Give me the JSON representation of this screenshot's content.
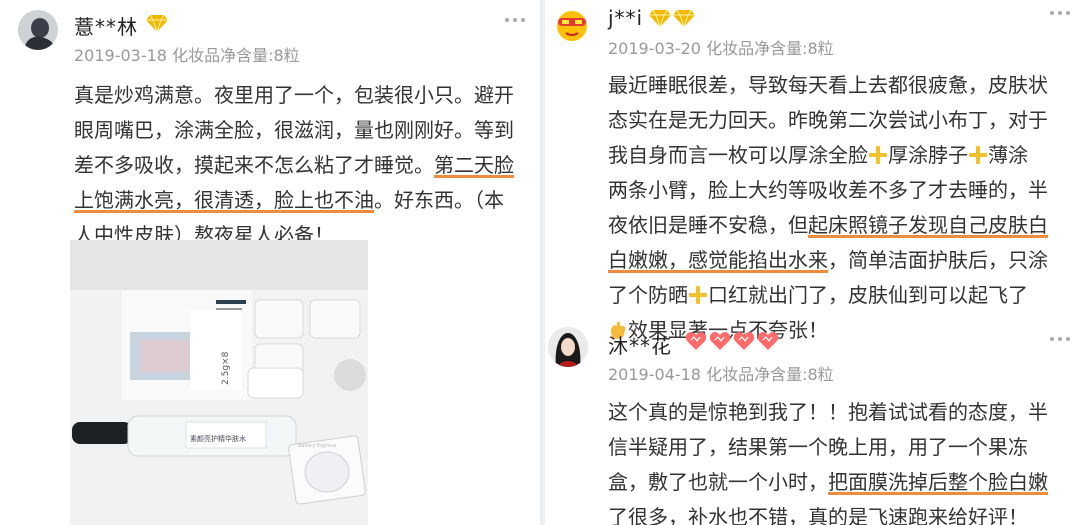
{
  "left_review": {
    "username": "薏**林",
    "date": "2019-03-18",
    "product": "化妆品净含量:8粒",
    "lines": [
      [
        {
          "t": "真是炒鸡满意。夜里用了一个，包装很小只。避开"
        }
      ],
      [
        {
          "t": "眼周嘴巴，涂满全脸，很滋润，量也刚刚好。等到"
        }
      ],
      [
        {
          "t": "差不多吸收，摸起来不怎么粘了才睡觉。"
        },
        {
          "t": "第二天脸",
          "hl": true
        }
      ],
      [
        {
          "t": "上饱满水亮，很清透，脸上也不油",
          "hl": true
        },
        {
          "t": "。好东西。（本"
        }
      ],
      [
        {
          "t": "人中性皮肤）熬夜星人必备！"
        }
      ]
    ],
    "photo_labels": {
      "box_side": "2.5g×8",
      "bottle": "素颜亮护精华肤水",
      "cup": "Bakery Express"
    }
  },
  "right_review_1": {
    "username": "j**i",
    "date": "2019-03-20",
    "product": "化妆品净含量:8粒",
    "lines": [
      [
        {
          "t": "最近睡眠很差，导致每天看上去都很疲惫，皮肤状"
        }
      ],
      [
        {
          "t": "态实在是无力回天。昨晚第二次尝试小布丁，对于"
        }
      ],
      [
        {
          "t": "我自身而言一枚可以厚涂全脸"
        },
        {
          "e": "plus"
        },
        {
          "t": "厚涂脖子"
        },
        {
          "e": "plus"
        },
        {
          "t": "薄涂"
        }
      ],
      [
        {
          "t": "两条小臂，脸上大约等吸收差不多了才去睡的，半"
        }
      ],
      [
        {
          "t": "夜依旧是睡不安稳，但"
        },
        {
          "t": "起床照镜子发现自己皮肤白",
          "hl": true
        }
      ],
      [
        {
          "t": "白嫩嫩，感觉能掐出水来",
          "hl": true
        },
        {
          "t": "，简单洁面护肤后，只涂"
        }
      ],
      [
        {
          "t": "了个防晒"
        },
        {
          "e": "plus"
        },
        {
          "t": "口红就出门了，皮肤仙到可以起飞了"
        }
      ],
      [
        {
          "e": "hand"
        },
        {
          "t": "效果显著一点不夸张！"
        }
      ]
    ]
  },
  "right_review_2": {
    "username": "沐**花",
    "date": "2019-04-18",
    "product": "化妆品净含量:8粒",
    "lines": [
      [
        {
          "t": "这个真的是惊艳到我了！！抱着试试看的态度，半"
        }
      ],
      [
        {
          "t": "信半疑用了，结果第一个晚上用，用了一个果冻"
        }
      ],
      [
        {
          "t": "盒，敷了也就一个小时，"
        },
        {
          "t": "把面膜洗掉后整个脸白嫩",
          "hl": true
        }
      ],
      [
        {
          "t": "了很多，补水也不错",
          "hl": true
        },
        {
          "t": "，真的是飞速跑来给好评！"
        }
      ]
    ]
  },
  "colors": {
    "underline": "#f08a3c",
    "diamond": "#f5b800",
    "heart": "#ff6b6b"
  }
}
